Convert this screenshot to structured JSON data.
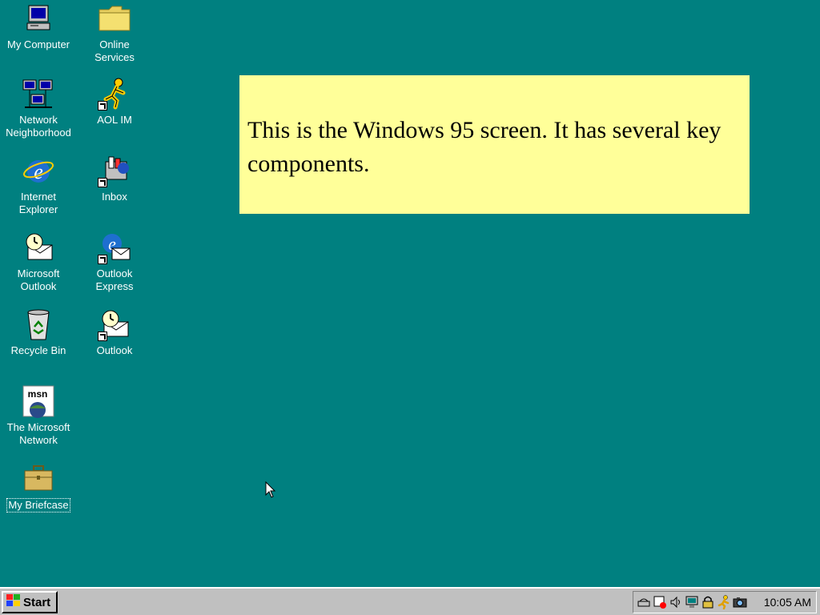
{
  "desktop": {
    "icons": [
      {
        "label": "My Computer",
        "icon": "computer-icon"
      },
      {
        "label": "Online\nServices",
        "icon": "folder-icon"
      },
      {
        "label": "Network\nNeighborhood",
        "icon": "network-icon"
      },
      {
        "label": "AOL IM",
        "icon": "aol-running-man-icon"
      },
      {
        "label": "Internet\nExplorer",
        "icon": "internet-explorer-icon"
      },
      {
        "label": "Inbox",
        "icon": "inbox-icon"
      },
      {
        "label": "Microsoft\nOutlook",
        "icon": "outlook-icon"
      },
      {
        "label": "Outlook\nExpress",
        "icon": "outlook-express-icon"
      },
      {
        "label": "Recycle Bin",
        "icon": "recycle-bin-icon"
      },
      {
        "label": "Outlook",
        "icon": "outlook-icon"
      },
      {
        "label": "The Microsoft\nNetwork",
        "icon": "msn-icon"
      },
      {
        "label": "My Briefcase",
        "icon": "briefcase-icon"
      }
    ]
  },
  "note": {
    "text": "This is the Windows 95 screen. It has several key components."
  },
  "taskbar": {
    "start_label": "Start",
    "clock": "10:05 AM",
    "tray_icons": [
      "modem-icon",
      "scheduler-icon",
      "volume-icon",
      "monitor-icon",
      "lock-icon",
      "aol-running-man-icon",
      "camera-icon"
    ]
  },
  "colors": {
    "desktop": "#008080",
    "taskbar": "#c0c0c0",
    "note_background": "#ffff99"
  }
}
